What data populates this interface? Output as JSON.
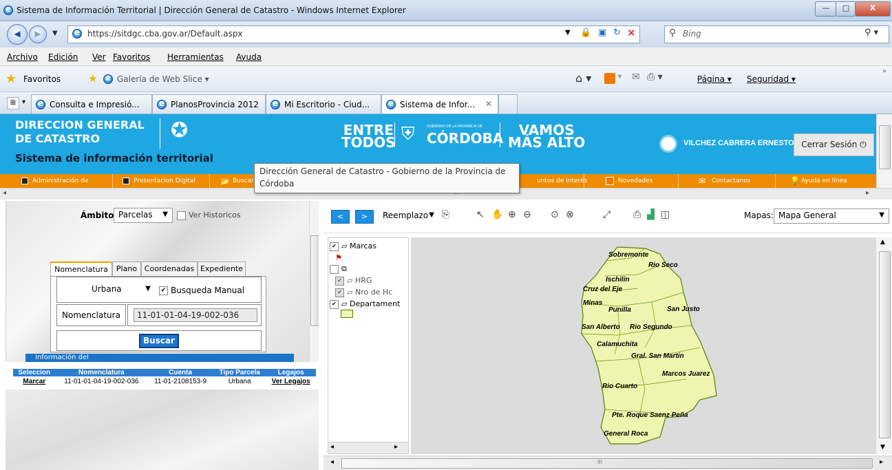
{
  "window": {
    "title": "Sistema de Información Territorial | Dirección General de Catastro - Windows Internet Explorer",
    "minimize": "—",
    "maximize": "□",
    "close": "X"
  },
  "address": {
    "url": "https://sitdgc.cba.gov.ar/Default.aspx",
    "search_placeholder": "Bing"
  },
  "menu": [
    "Archivo",
    "Edición",
    "Ver",
    "Favoritos",
    "Herramientas",
    "Ayuda"
  ],
  "favorites_bar": {
    "favorites": "Favoritos",
    "web_slice": "Galería de Web Slice ▾",
    "page": "Página ▾",
    "security": "Seguridad ▾"
  },
  "browser_tabs": [
    {
      "label": "Consulta e Impresió..."
    },
    {
      "label": "PlanosProvincia 2012"
    },
    {
      "label": "Mi Escritorio - Ciud..."
    },
    {
      "label": "Sistema de Infor..."
    }
  ],
  "site": {
    "logo_line1": "DIRECCION GENERAL",
    "logo_line2": "DE CATASTRO",
    "subtitle": "Sistema de información territorial",
    "entre_todos_1": "ENTRE",
    "entre_todos_2": "TODOS",
    "gobierno": "GOBIERNO DE LA PROVINCIA DE",
    "cordoba": "CÓRDOBA",
    "vamos_1": "VAMOS",
    "vamos_2": "MÁS ALTO",
    "user": "VILCHEZ CABRERA ERNESTO",
    "logout": "Cerrar Sesión",
    "nav": [
      {
        "label": "Administración de"
      },
      {
        "label": "Presentacion Digital"
      },
      {
        "label": "Buscar"
      },
      {
        "label": "untos de Interés"
      },
      {
        "label": "Novedades"
      },
      {
        "label": "Contactanos"
      },
      {
        "label": "Ayuda en línea"
      }
    ],
    "tooltip": "Dirección General de Catastro - Gobierno de la Provincia de Córdoba"
  },
  "search": {
    "ambito_label": "Ámbito:",
    "ambito_value": "Parcelas",
    "historicos": "Ver Historicos",
    "tabs": [
      "Nomenclatura",
      "Plano",
      "Coordenadas",
      "Expediente"
    ],
    "tipo_value": "Urbana",
    "busqueda_manual": "Busqueda Manual",
    "nomenclatura_label": "Nomenclatura",
    "nomenclatura_value": "11-01-01-04-19-002-036",
    "buscar": "Buscar",
    "info_tab": "Información del"
  },
  "results": {
    "headers": [
      "Seleccion",
      "Nomenclatura",
      "Cuenta",
      "Tipo Parcela",
      "Legajos"
    ],
    "rows": [
      {
        "sel": "Marcar",
        "nom": "11-01-01-04-19-002-036",
        "cuenta": "11-01-2108153-9",
        "tipo": "Urbana",
        "legajos": "Ver Legajos"
      }
    ]
  },
  "map_toolbar": {
    "prev": "<",
    "next": ">",
    "mode": "Reemplazo",
    "mapas_label": "Mapas:",
    "mapas_value": "Mapa General"
  },
  "legend": [
    {
      "label": "Marcas"
    },
    {
      "label": "HRG"
    },
    {
      "label": "Nro de Hc"
    },
    {
      "label": "Departament"
    }
  ],
  "departments": [
    "Sobremonte",
    "Rio Seco",
    "Ischilin",
    "Cruz del Eje",
    "Minas",
    "Punilla",
    "San Justo",
    "San Alberto",
    "Rio Segundo",
    "Calamuchita",
    "Gral. San Martin",
    "Marcos Juarez",
    "Rio Cuarto",
    "Pte. Roque Saenz Peña",
    "General Roca"
  ],
  "colors": {
    "site_blue": "#1ea7e1",
    "nav_orange": "#ee8b00",
    "map_fill": "#eef5b0",
    "map_stroke": "#5a7d00"
  },
  "scroll_marks": {
    "ellipsis": "III"
  }
}
